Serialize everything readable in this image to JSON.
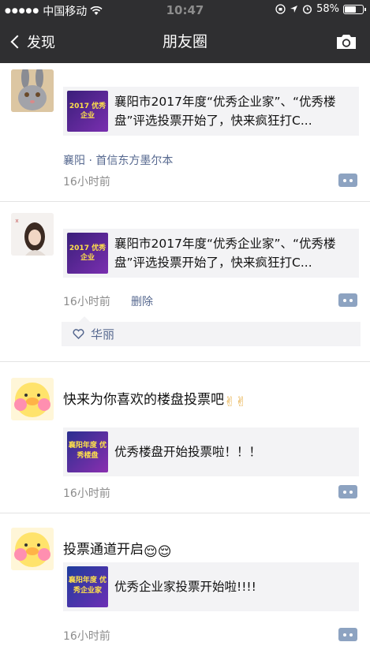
{
  "status_bar": {
    "carrier": "中国移动",
    "time": "10:47",
    "battery": "58%"
  },
  "nav": {
    "back_label": "发现",
    "title": "朋友圈"
  },
  "posts": [
    {
      "link_title": "襄阳市2017年度“优秀企业家”、“优秀楼盘”评选投票开始了，快来疯狂打C...",
      "thumb_text": "2017 优秀企业",
      "location": "襄阳 · 首信东方墨尔本",
      "time": "16小时前"
    },
    {
      "link_title": "襄阳市2017年度“优秀企业家”、“优秀楼盘”评选投票开始了，快来疯狂打C...",
      "thumb_text": "2017 优秀企业",
      "time": "16小时前",
      "delete_label": "删除",
      "liker": "华丽"
    },
    {
      "text": "快来为你喜欢的楼盘投票吧",
      "text_emoji": "✌✌",
      "link_title": "优秀楼盘开始投票啦！！！",
      "thumb_text": "襄阳年度 优秀楼盘",
      "time": "16小时前"
    },
    {
      "text": "投票通道开启",
      "text_emoji": "😌😌",
      "link_title": "优秀企业家投票开始啦!!!!",
      "thumb_text": "襄阳年度 优秀企业家",
      "time": "16小时前"
    }
  ],
  "colors": {
    "bar_bg": "#2f2f31",
    "link_blue": "#56688f",
    "card_bg": "#f3f3f5"
  }
}
